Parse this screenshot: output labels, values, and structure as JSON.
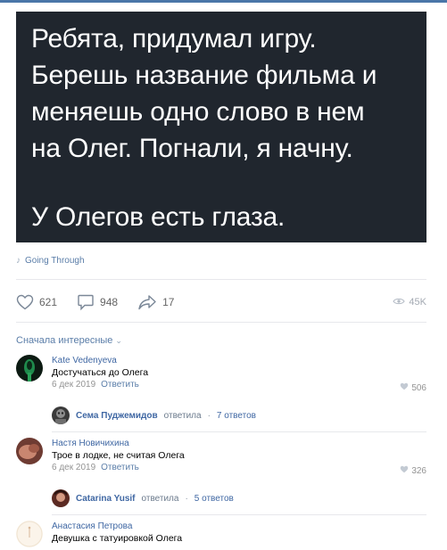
{
  "post": {
    "image_lines": [
      "Ребята, придумал игру.",
      "Берешь название фильма и",
      "меняешь одно слово в нем",
      "на Олег. Погнали, я начну."
    ],
    "image_punchline": "У Олегов есть глаза.",
    "attachment": {
      "icon": "music-note-icon",
      "title": "Going Through"
    }
  },
  "actions": {
    "likes": "621",
    "comments": "948",
    "shares": "17",
    "views": "45K"
  },
  "comments_section": {
    "sort_label": "Сначала интересные",
    "comments": [
      {
        "author": "Kate Vedenyeva",
        "text": "Достучаться до Олега",
        "date": "6 дек 2019",
        "reply_label": "Ответить",
        "likes": "506",
        "thread": {
          "author": "Сема Пуджемидов",
          "replied": "ответила",
          "count": "7 ответов"
        }
      },
      {
        "author": "Настя Новичихина",
        "text": "Трое в лодке, не считая Олега",
        "date": "6 дек 2019",
        "reply_label": "Ответить",
        "likes": "326",
        "thread": {
          "author": "Catarina Yusif",
          "replied": "ответила",
          "count": "5 ответов"
        }
      },
      {
        "author": "Анастасия Петрова",
        "text": "Девушка с татуировкой Олега"
      }
    ]
  }
}
